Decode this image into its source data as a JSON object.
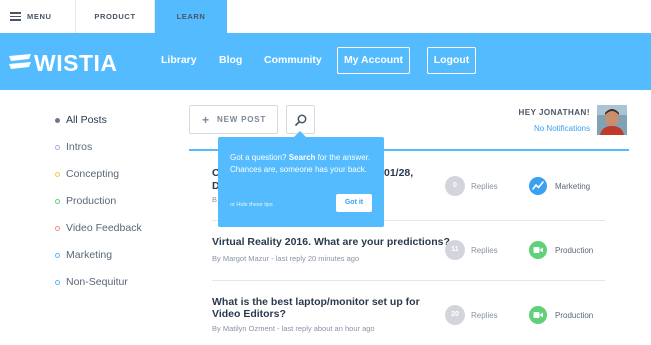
{
  "topbar": {
    "menu": "MENU",
    "product": "PRODUCT",
    "learn": "LEARN"
  },
  "header": {
    "logo": "WISTIA",
    "nav": [
      "Library",
      "Blog",
      "Community"
    ],
    "my_account": "My Account",
    "logout": "Logout"
  },
  "sidebar": {
    "items": [
      {
        "label": "All Posts",
        "color": "#6c7787",
        "active": true
      },
      {
        "label": "Intros",
        "color": "#b9a6e0"
      },
      {
        "label": "Concepting",
        "color": "#f3c64f"
      },
      {
        "label": "Production",
        "color": "#5fd17a"
      },
      {
        "label": "Video Feedback",
        "color": "#f28b8b"
      },
      {
        "label": "Marketing",
        "color": "#54bbff"
      },
      {
        "label": "Non-Sequitur",
        "color": "#54bbff"
      }
    ]
  },
  "toolbar": {
    "new_post": "NEW POST"
  },
  "user": {
    "greeting": "HEY JONATHAN!",
    "notifications": "No Notifications"
  },
  "tooltip": {
    "line_pre": "Got a question? ",
    "line_bold": "Search",
    "line_post": " for the answer. Chances are, someone has your back.",
    "hide": "or Hide these tips",
    "got_it": "Got it"
  },
  "posts": [
    {
      "title": "C",
      "title_tail": "01/28,",
      "title2": "D",
      "by": "B",
      "replies_count": "0",
      "replies_label": "Replies",
      "category": "Marketing",
      "category_color": "#3aa0f0"
    },
    {
      "title": "Virtual Reality 2016. What are your predictions?",
      "by": "By Margot Mazur - last reply 20 minutes ago",
      "replies_count": "11",
      "replies_label": "Replies",
      "category": "Production",
      "category_color": "#5fd17a"
    },
    {
      "title": "What is the best laptop/monitor set up for",
      "title2": "Video Editors?",
      "by": "By Matilyn Ozment - last reply about an hour ago",
      "replies_count": "20",
      "replies_label": "Replies",
      "category": "Production",
      "category_color": "#5fd17a"
    }
  ]
}
